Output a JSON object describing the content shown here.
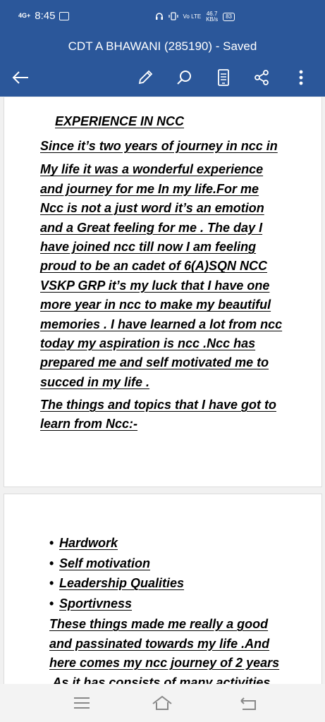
{
  "status_bar": {
    "network_top": "4G+",
    "time": "8:45",
    "volte": "Vo LTE",
    "speed_value": "46.7",
    "speed_unit": "KB/s",
    "battery": "83"
  },
  "app_bar": {
    "title": "CDT A BHAWANI (285190) - Saved",
    "icons": [
      "back-arrow-icon",
      "pencil-icon",
      "search-icon",
      "reading-view-icon",
      "share-icon",
      "more-vert-icon"
    ]
  },
  "document": {
    "heading": "EXPERIENCE IN NCC",
    "para1_lines": [
      "Since it’s two years of journey in ncc in",
      "My life it was a wonderful experience",
      "and journey for me In my life.For me",
      "Ncc is not a just word it’s an emotion",
      "and a  Great feeling for me . The day I",
      "have joined ncc till now I am feeling",
      "proud to be an cadet of 6(A)SQN NCC",
      "VSKP GRP it’s my luck that I have one",
      "more year in ncc to make my beautiful",
      "memories . I have learned a lot from ncc",
      "today my aspiration is ncc .Ncc has",
      "prepared me and self motivated me to",
      "succed in my life ."
    ],
    "para2_lines": [
      "The things and topics that I have got to",
      "learn from Ncc:-"
    ],
    "bullets": [
      "Hardwork",
      "Self motivation",
      "Leadership Qualities",
      "Sportivness"
    ],
    "para3_lines": [
      "These things made me really a good",
      "and passinated towards my life .And",
      "here comes my ncc journey of 2 years",
      " As it has consists of many activities"
    ]
  },
  "nav_bar": {
    "icons": [
      "menu-icon",
      "home-icon",
      "back-icon"
    ]
  }
}
